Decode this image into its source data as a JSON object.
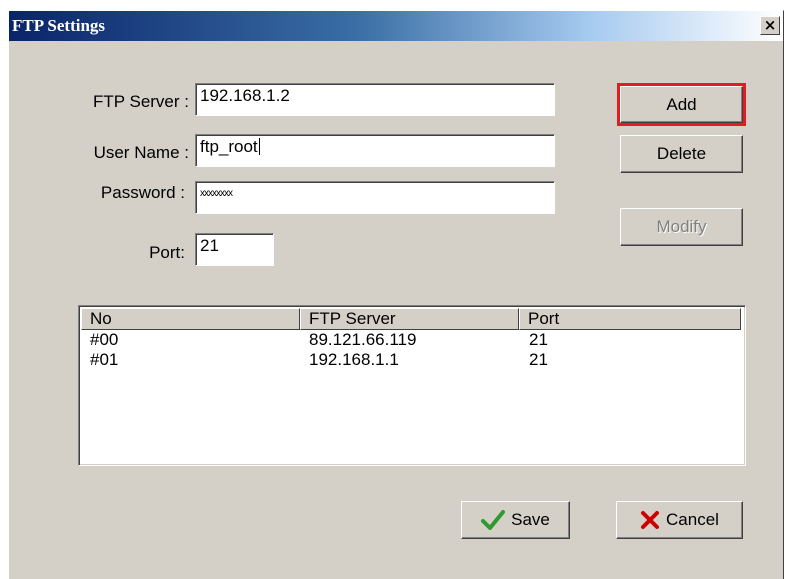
{
  "window": {
    "title": "FTP Settings",
    "close_symbol": "×"
  },
  "form": {
    "ftp_server_label": "FTP Server :",
    "ftp_server_value": "192.168.1.2",
    "user_name_label": "User Name :",
    "user_name_value": "ftp_root",
    "password_label": "Password :",
    "password_value": "xxxxxxxx",
    "port_label": "Port:",
    "port_value": "21"
  },
  "buttons": {
    "add": "Add",
    "delete": "Delete",
    "modify": "Modify",
    "save": "Save",
    "cancel": "Cancel"
  },
  "table": {
    "headers": [
      "No",
      "FTP Server",
      "Port"
    ],
    "rows": [
      [
        "#00",
        "89.121.66.119",
        "21"
      ],
      [
        "#01",
        "192.168.1.1",
        "21"
      ]
    ]
  },
  "icons": {
    "save": "checkmark-icon",
    "cancel": "x-mark-icon",
    "close": "close-icon"
  },
  "colors": {
    "highlight": "#e31b23",
    "save_check": "#2e9b2e",
    "cancel_x": "#cc0000",
    "title_bar": "#0a246a"
  }
}
